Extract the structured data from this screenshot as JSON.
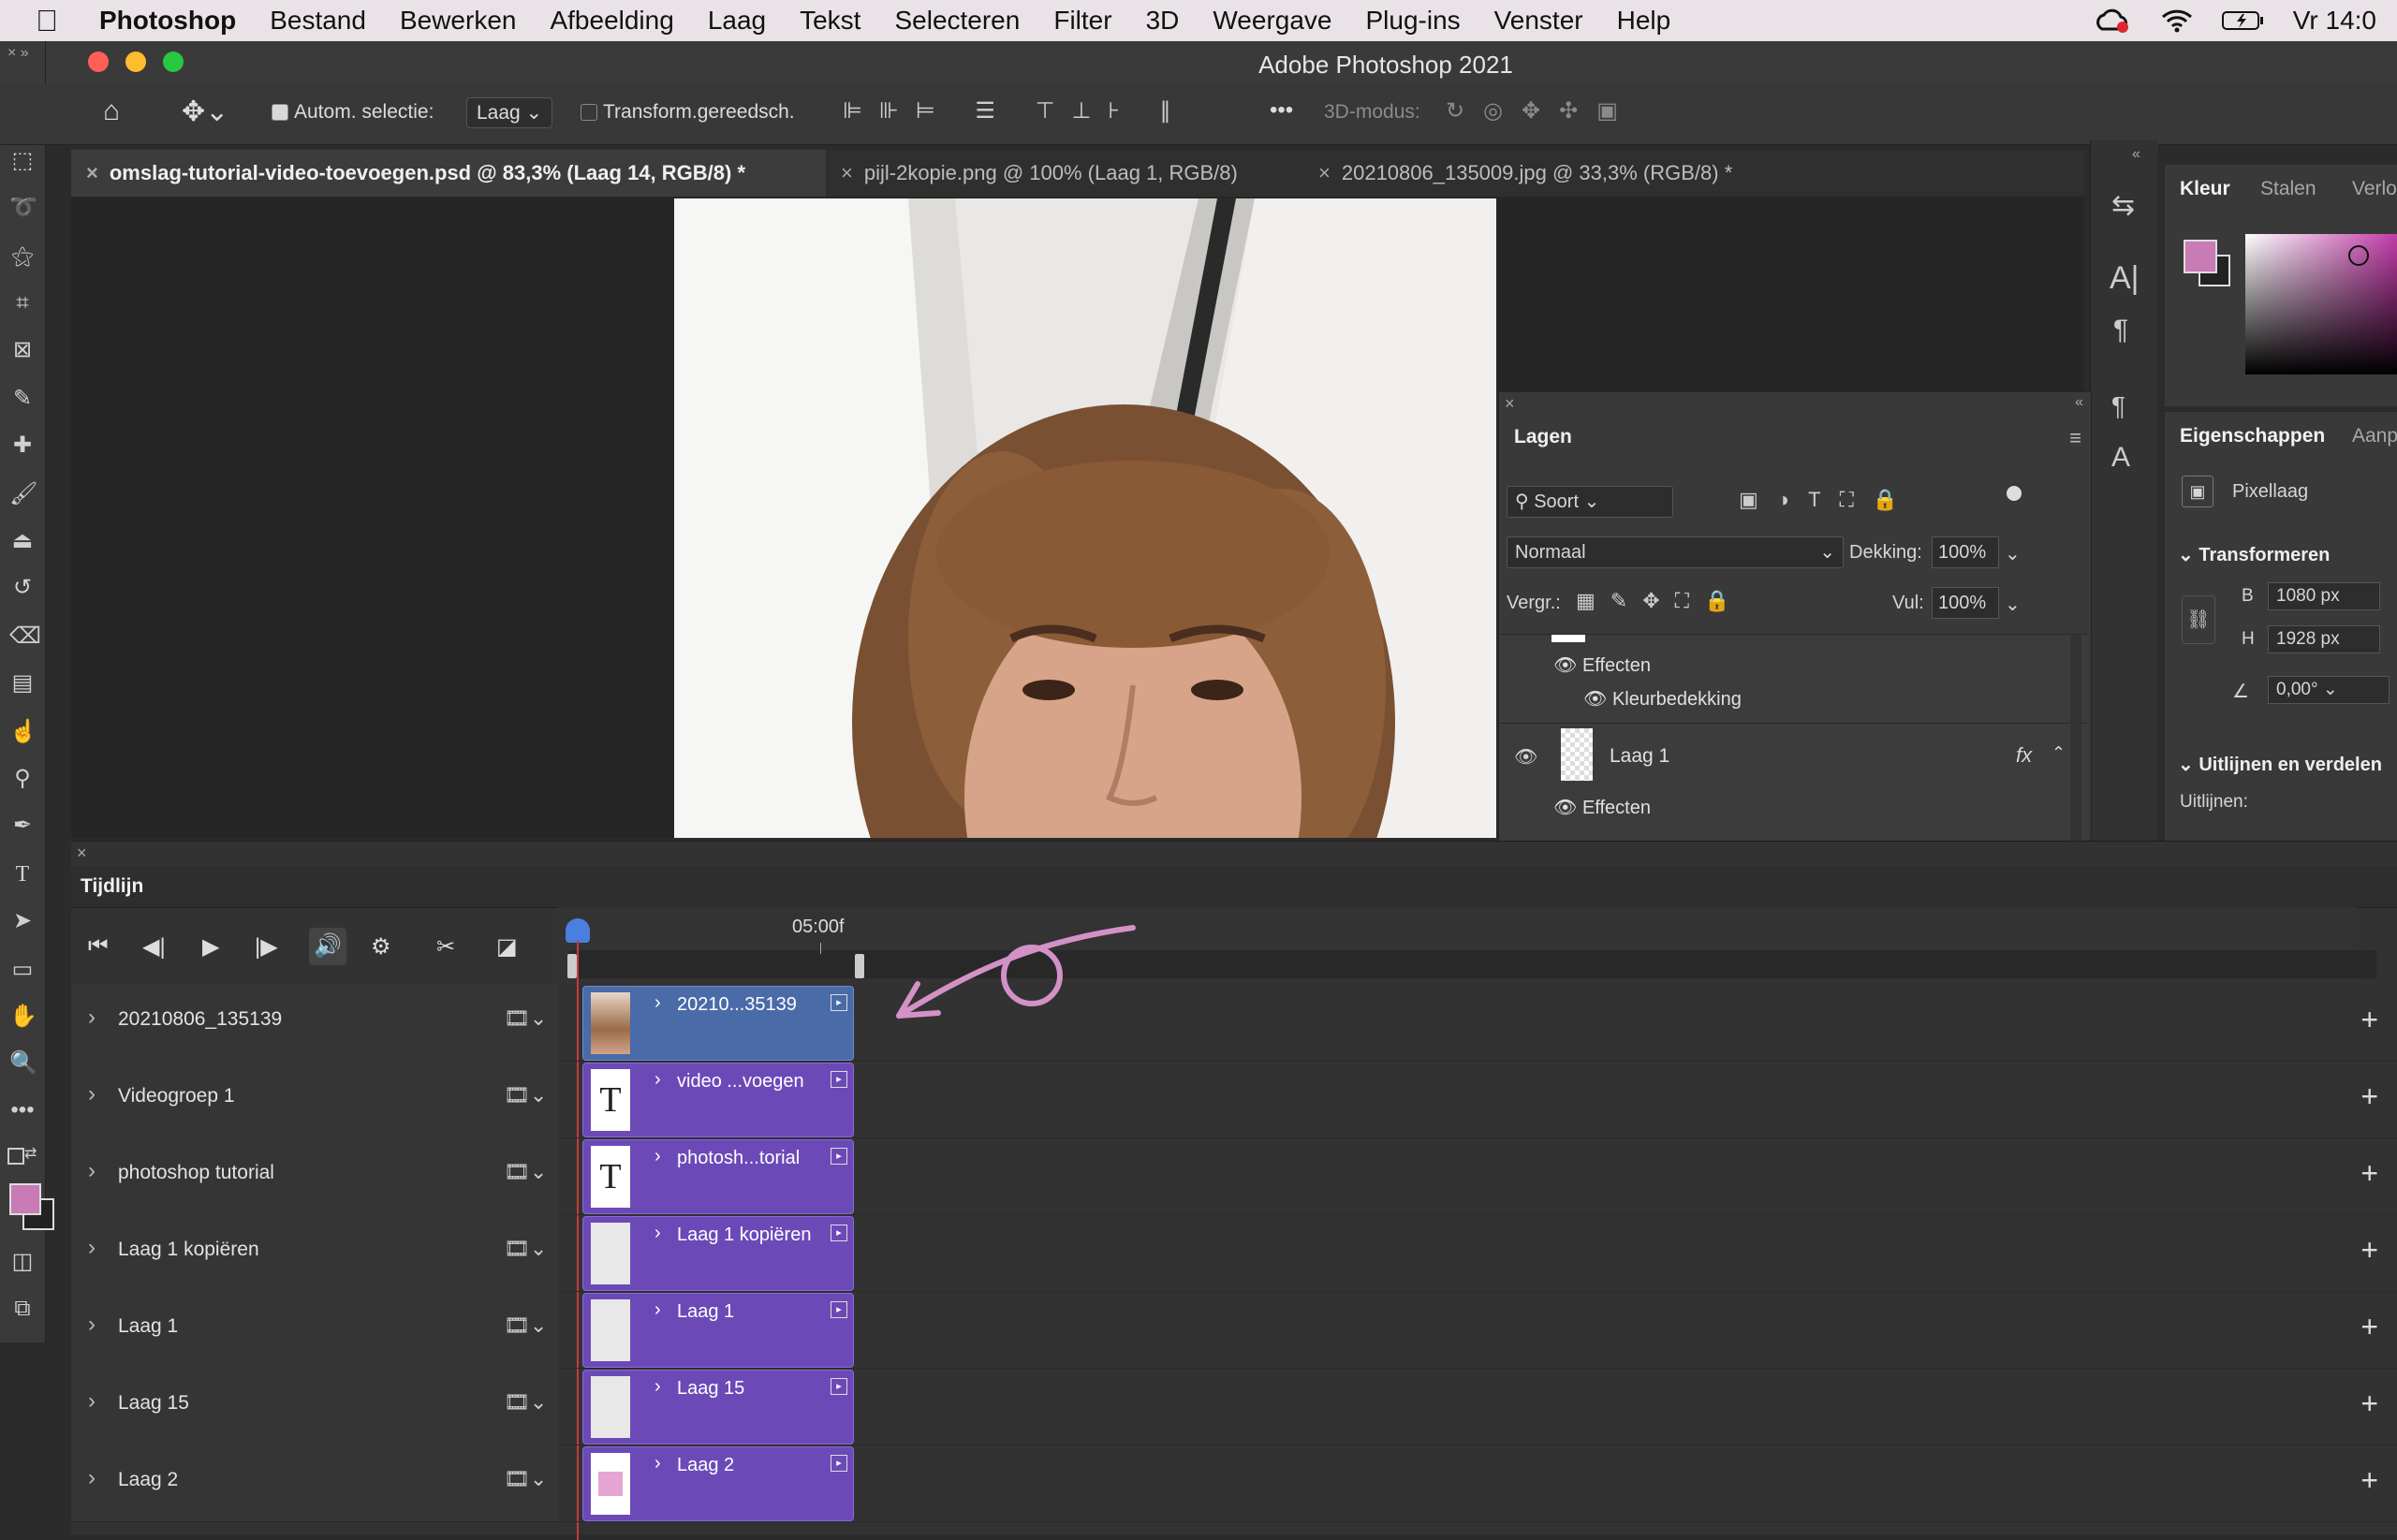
{
  "menubar": {
    "app": "Photoshop",
    "items": [
      "Bestand",
      "Bewerken",
      "Afbeelding",
      "Laag",
      "Tekst",
      "Selecteren",
      "Filter",
      "3D",
      "Weergave",
      "Plug-ins",
      "Venster",
      "Help"
    ],
    "clock": "Vr 14:0"
  },
  "window": {
    "title": "Adobe Photoshop 2021"
  },
  "options": {
    "auto_select_label": "Autom. selectie:",
    "auto_select_value": "Laag",
    "transform_label": "Transform.gereedsch.",
    "mode3d_label": "3D-modus:"
  },
  "tabs": [
    {
      "label": "omslag-tutorial-video-toevoegen.psd @ 83,3% (Laag 14, RGB/8) *"
    },
    {
      "label": "pijl-2kopie.png @ 100% (Laag 1, RGB/8)"
    },
    {
      "label": "20210806_135009.jpg @ 33,3% (RGB/8) *"
    }
  ],
  "color_panel": {
    "tabs": [
      "Kleur",
      "Stalen",
      "Verlo"
    ],
    "foreground": "#c87bb5",
    "background": "#222222"
  },
  "properties_panel": {
    "tabs": [
      "Eigenschappen",
      "Aanp"
    ],
    "layer_type": "Pixellaag",
    "section_transform": "Transformeren",
    "w_label": "B",
    "w_value": "1080 px",
    "h_label": "H",
    "h_value": "1928 px",
    "angle_value": "0,00°",
    "section_align": "Uitlijnen en verdelen",
    "align_label": "Uitlijnen:"
  },
  "layers_panel": {
    "title": "Lagen",
    "filter_label": "Soort",
    "blend_mode": "Normaal",
    "opacity_label": "Dekking:",
    "opacity_value": "100%",
    "lock_label": "Vergr.:",
    "fill_label": "Vul:",
    "fill_value": "100%",
    "rows": {
      "effects1": "Effecten",
      "color_overlay1": "Kleurbedekking",
      "layer1": "Laag 1",
      "fx": "fx",
      "effects2": "Effecten"
    }
  },
  "timeline": {
    "title": "Tijdlijn",
    "time_marker": "05:00f",
    "tracks": [
      {
        "name": "20210806_135139",
        "clip": "20210...35139",
        "kind": "photo"
      },
      {
        "name": "Videogroep 1",
        "clip": "video ...voegen",
        "kind": "text"
      },
      {
        "name": "photoshop tutorial",
        "clip": "photosh...torial",
        "kind": "text"
      },
      {
        "name": "Laag 1 kopiëren",
        "clip": "Laag 1 kopiëren",
        "kind": "checker"
      },
      {
        "name": "Laag 1",
        "clip": "Laag 1",
        "kind": "checker"
      },
      {
        "name": "Laag 15",
        "clip": "Laag 15",
        "kind": "checker"
      },
      {
        "name": "Laag 2",
        "clip": "Laag 2",
        "kind": "pink"
      }
    ]
  },
  "icons": {
    "thumb_text_glyph": "T"
  },
  "colors": {
    "accent_pink": "#c87bb5",
    "clip_purple": "#6b4ab8",
    "clip_blue": "#4a6aa8",
    "arrow_pink": "#d391c6"
  }
}
